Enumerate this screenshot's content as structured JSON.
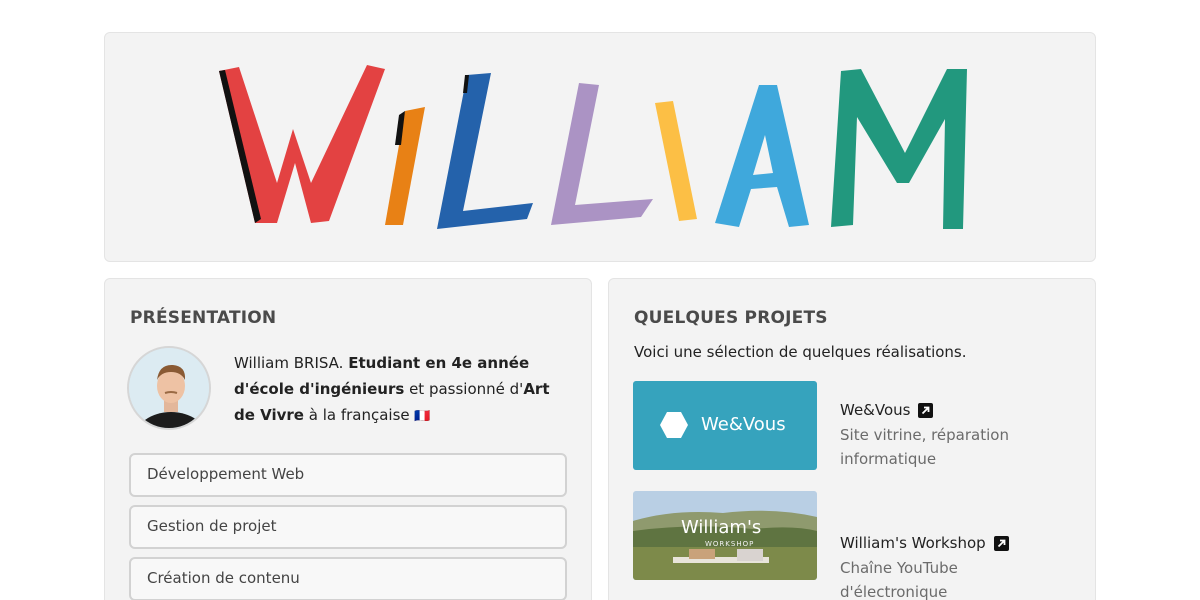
{
  "hero": {
    "logo_text": "WILLIAM"
  },
  "presentation": {
    "title": "PRÉSENTATION",
    "name_text": "William BRISA.",
    "bold1": "Etudiant en 4e année d'école d'ingénieurs",
    "mid_text": "et passionné d'",
    "bold2": "Art de Vivre",
    "tail_text": "à la française",
    "flag": "🇫🇷",
    "skills": [
      "Développement Web",
      "Gestion de projet",
      "Création de contenu"
    ]
  },
  "projects": {
    "title": "QUELQUES PROJETS",
    "subtitle": "Voici une sélection de quelques réalisations.",
    "items": [
      {
        "name": "We&Vous",
        "description": "Site vitrine, réparation informatique",
        "thumb_text": "We&Vous",
        "thumb_color": "#36a3bd"
      },
      {
        "name": "William's Workshop",
        "description": "Chaîne YouTube d'électronique",
        "thumb_text": "William's",
        "thumb_subtext": "WORKSHOP"
      }
    ]
  },
  "colors": {
    "W": "#e34242",
    "I1": "#e88115",
    "L1": "#2462ab",
    "L2": "#ab93c4",
    "I2": "#fcbf45",
    "A": "#3fa8dc",
    "M": "#22987e"
  }
}
